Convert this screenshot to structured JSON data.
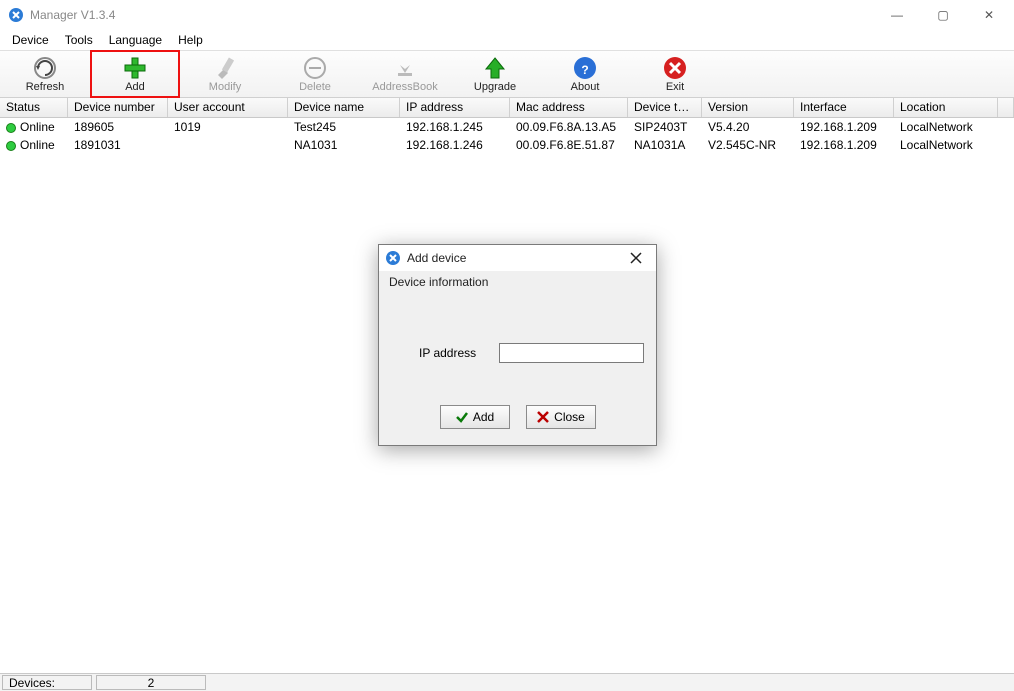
{
  "window": {
    "title": "Manager V1.3.4",
    "controls": {
      "min": "—",
      "max": "▢",
      "close": "✕"
    }
  },
  "menu": {
    "device": "Device",
    "tools": "Tools",
    "language": "Language",
    "help": "Help"
  },
  "toolbar": {
    "refresh": "Refresh",
    "add": "Add",
    "modify": "Modify",
    "delete": "Delete",
    "addressbook": "AddressBook",
    "upgrade": "Upgrade",
    "about": "About",
    "exit": "Exit"
  },
  "columns": {
    "status": "Status",
    "devnum": "Device number",
    "user": "User account",
    "devname": "Device name",
    "ip": "IP address",
    "mac": "Mac address",
    "type": "Device type",
    "ver": "Version",
    "iface": "Interface",
    "loc": "Location"
  },
  "rows": [
    {
      "status": "Online",
      "devnum": "189605",
      "user": "1019",
      "devname": "Test245",
      "ip": "192.168.1.245",
      "mac": "00.09.F6.8A.13.A5",
      "type": "SIP2403T",
      "ver": "V5.4.20",
      "iface": "192.168.1.209",
      "loc": "LocalNetwork"
    },
    {
      "status": "Online",
      "devnum": "1891031",
      "user": "",
      "devname": "NA1031",
      "ip": "192.168.1.246",
      "mac": "00.09.F6.8E.51.87",
      "type": "NA1031A",
      "ver": "V2.545C-NR",
      "iface": "192.168.1.209",
      "loc": "LocalNetwork"
    }
  ],
  "statusbar": {
    "label": "Devices:",
    "count": "2"
  },
  "dialog": {
    "title": "Add device",
    "group": "Device information",
    "iplabel": "IP address",
    "ipvalue": "",
    "add": "Add",
    "close": "Close"
  }
}
